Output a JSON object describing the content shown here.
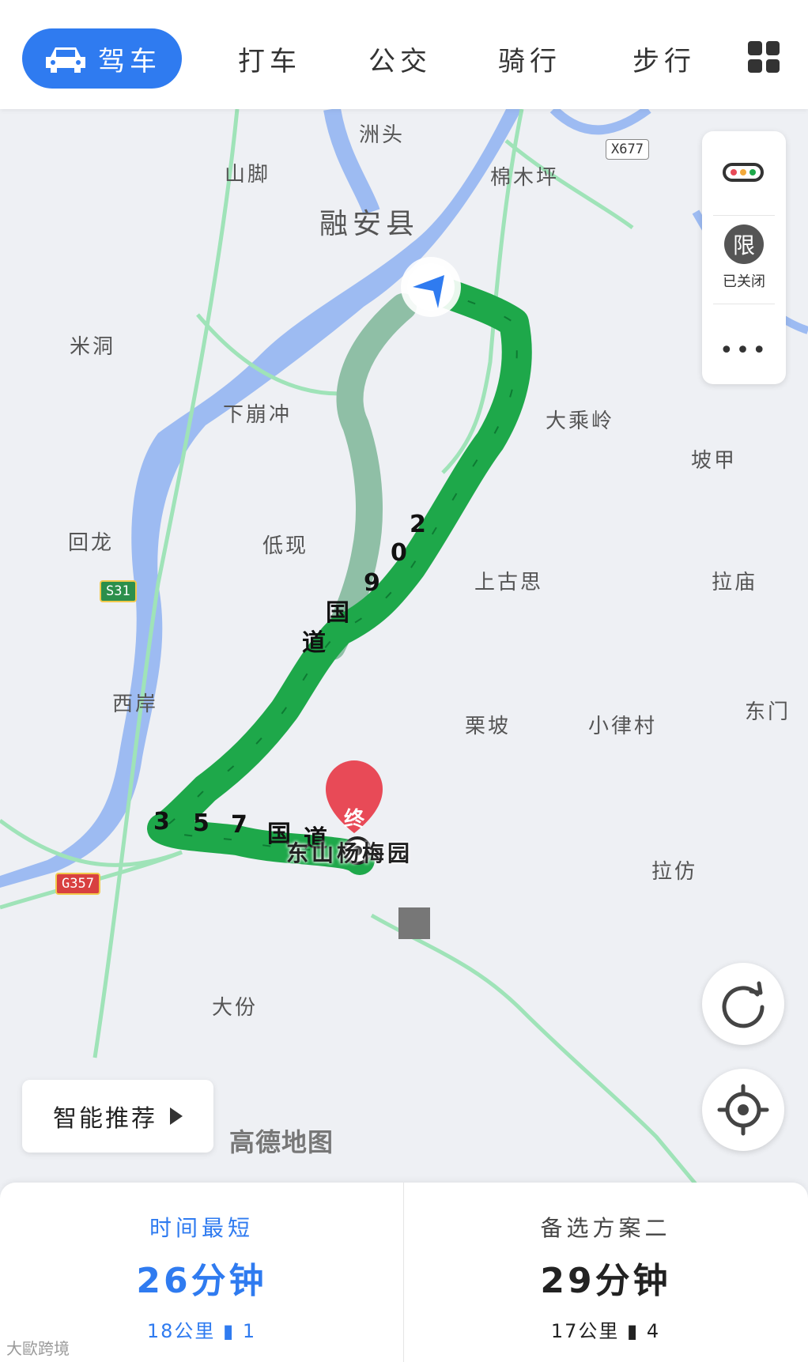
{
  "tabs": [
    {
      "label": "驾车",
      "active": true
    },
    {
      "label": "打车",
      "active": false
    },
    {
      "label": "公交",
      "active": false
    },
    {
      "label": "骑行",
      "active": false
    },
    {
      "label": "步行",
      "active": false
    }
  ],
  "map": {
    "places": [
      "洲头",
      "山脚",
      "棉木坪",
      "融安县",
      "米洞",
      "下崩冲",
      "大乘岭",
      "坡甲",
      "回龙",
      "低现",
      "上古思",
      "拉庙",
      "西岸",
      "栗坡",
      "小律村",
      "东门",
      "拉仿",
      "大份"
    ],
    "road_badges": [
      "X677",
      "S31",
      "G357"
    ],
    "route_labels": [
      "2",
      "0",
      "9",
      "国",
      "道",
      "3",
      "5",
      "7",
      "国",
      "道"
    ],
    "destination_marker": "终",
    "destination_name": "东山杨梅园",
    "logo": "高德地图"
  },
  "controls": {
    "limit_icon": "限",
    "limit_status": "已关闭",
    "more": "•••"
  },
  "smart_recommend": "智能推荐",
  "routes": [
    {
      "label": "时间最短",
      "duration": "26分钟",
      "distance": "18公里",
      "lights": "1",
      "color": "#2f7bf0"
    },
    {
      "label": "备选方案二",
      "duration": "29分钟",
      "distance": "17公里",
      "lights": "4",
      "color": "#222222"
    }
  ],
  "watermark": "大歐跨境",
  "colors": {
    "accent": "#2f7bf0",
    "route": "#1ea84a",
    "destination": "#e84a57"
  }
}
